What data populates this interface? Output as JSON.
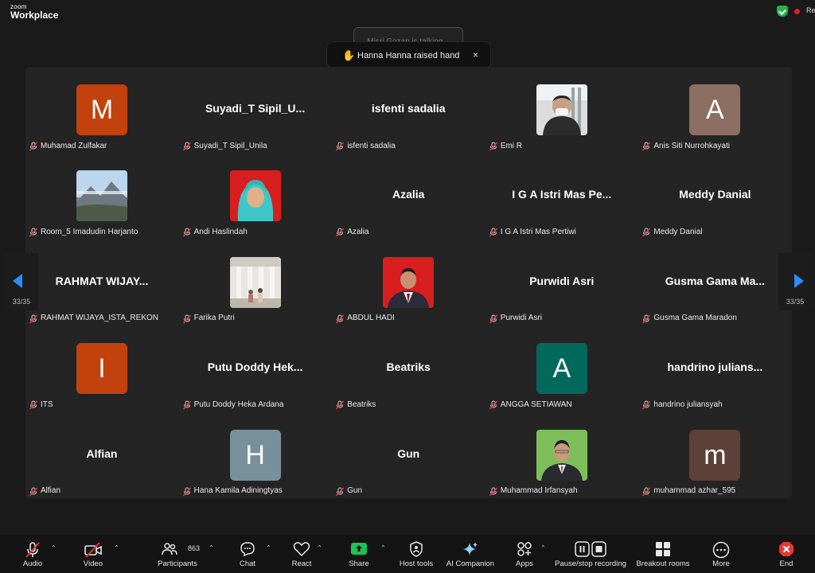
{
  "app": {
    "brand_small": "zoom",
    "brand_main": "Workplace",
    "rec_text": "Re"
  },
  "notifications": {
    "talking": "Misri Gozan is talking...",
    "toast": "Hanna Hanna raised hand",
    "toast_close": "×"
  },
  "pager": {
    "left": "33/35",
    "right": "33/35"
  },
  "participants": [
    {
      "name": "Muhamad Zulfakar",
      "type": "initial",
      "initial": "M",
      "color": "#c2410c"
    },
    {
      "name": "Suyadi_T Sipil_Unila",
      "type": "name",
      "display": "Suyadi_T  Sipil_U..."
    },
    {
      "name": "isfenti sadalia",
      "type": "name",
      "display": "isfenti sadalia"
    },
    {
      "name": "Emi R",
      "type": "photo",
      "photo": "person-masked"
    },
    {
      "name": "Anis Siti Nurrohkayati",
      "type": "initial",
      "initial": "A",
      "color": "#8d6e63"
    },
    {
      "name": "Room_5 Imadudin Harjanto",
      "type": "photo",
      "photo": "mountain"
    },
    {
      "name": "Andi Haslindah",
      "type": "photo",
      "photo": "hijab-red"
    },
    {
      "name": "Azalia",
      "type": "name",
      "display": "Azalia"
    },
    {
      "name": "I G A Istri Mas Pertiwi",
      "type": "name",
      "display": "I G A Istri Mas Pe..."
    },
    {
      "name": "Meddy Danial",
      "type": "name",
      "display": "Meddy Danial"
    },
    {
      "name": "RAHMAT WIJAYA_ISTA_REKON",
      "type": "name",
      "display": "RAHMAT  WIJAY..."
    },
    {
      "name": "Farika Putri",
      "type": "photo",
      "photo": "building"
    },
    {
      "name": "ABDUL HADI",
      "type": "photo",
      "photo": "man-red"
    },
    {
      "name": "Purwidi Asri",
      "type": "name",
      "display": "Purwidi Asri"
    },
    {
      "name": "Gusma Gama Maradon",
      "type": "name",
      "display": "Gusma  Gama  Ma..."
    },
    {
      "name": "ITS",
      "type": "initial",
      "initial": "I",
      "color": "#c2410c"
    },
    {
      "name": "Putu Doddy Heka Ardana",
      "type": "name",
      "display": "Putu Doddy Hek..."
    },
    {
      "name": "Beatriks",
      "type": "name",
      "display": "Beatriks"
    },
    {
      "name": "ANGGA SETIAWAN",
      "type": "initial",
      "initial": "A",
      "color": "#00695c"
    },
    {
      "name": "handrino juliansyah",
      "type": "name",
      "display": "handrino  julians..."
    },
    {
      "name": "Alfian",
      "type": "name",
      "display": "Alfian"
    },
    {
      "name": "Hana Kamila Adiningtyas",
      "type": "initial",
      "initial": "H",
      "color": "#78909c"
    },
    {
      "name": "Gun",
      "type": "name",
      "display": "Gun"
    },
    {
      "name": "Muhammad Irfansyah",
      "type": "photo",
      "photo": "man-green"
    },
    {
      "name": "muhammad azhar_595",
      "type": "initial",
      "initial": "m",
      "color": "#5d4037"
    }
  ],
  "toolbar": {
    "audio": "Audio",
    "video": "Video",
    "participants": "Participants",
    "participants_count": "863",
    "chat": "Chat",
    "react": "React",
    "share": "Share",
    "host_tools": "Host tools",
    "ai_companion": "AI Companion",
    "apps": "Apps",
    "pause_recording": "Pause/stop recording",
    "breakout_rooms": "Breakout rooms",
    "more": "More",
    "end": "End"
  },
  "colors": {
    "share_green": "#1fbf5a",
    "end_red": "#e53935",
    "nav_blue": "#2b8cff"
  }
}
